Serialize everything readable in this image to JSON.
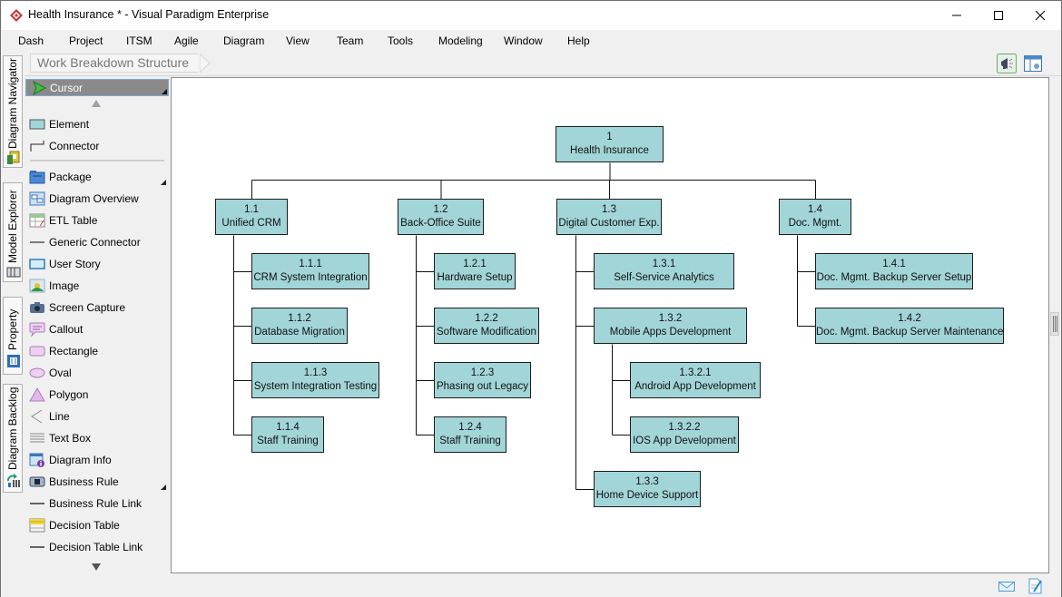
{
  "window": {
    "title": "Health Insurance * - Visual Paradigm Enterprise",
    "controls": [
      "minimize",
      "maximize",
      "close"
    ]
  },
  "menu": [
    "Dash",
    "Project",
    "ITSM",
    "Agile",
    "Diagram",
    "View",
    "Team",
    "Tools",
    "Modeling",
    "Window",
    "Help"
  ],
  "breadcrumb": {
    "label": "Work Breakdown Structure"
  },
  "toolbar": {
    "buttons": [
      "announcement-icon",
      "diagram-layout-icon"
    ]
  },
  "side_tabs": [
    "Diagram Navigator",
    "Model Explorer",
    "Property",
    "Diagram Backlog"
  ],
  "palette": {
    "selected": "Cursor",
    "items": [
      {
        "label": "Element",
        "icon": "element-icon"
      },
      {
        "label": "Connector",
        "icon": "connector-icon"
      },
      {
        "label": "Package",
        "icon": "package-icon",
        "submenu": true
      },
      {
        "label": "Diagram Overview",
        "icon": "diagram-overview-icon"
      },
      {
        "label": "ETL Table",
        "icon": "etl-table-icon"
      },
      {
        "label": "Generic Connector",
        "icon": "generic-connector-icon"
      },
      {
        "label": "User Story",
        "icon": "user-story-icon"
      },
      {
        "label": "Image",
        "icon": "image-icon"
      },
      {
        "label": "Screen Capture",
        "icon": "camera-icon"
      },
      {
        "label": "Callout",
        "icon": "callout-icon"
      },
      {
        "label": "Rectangle",
        "icon": "rectangle-icon"
      },
      {
        "label": "Oval",
        "icon": "oval-icon"
      },
      {
        "label": "Polygon",
        "icon": "polygon-icon"
      },
      {
        "label": "Line",
        "icon": "line-icon"
      },
      {
        "label": "Text Box",
        "icon": "text-box-icon"
      },
      {
        "label": "Diagram Info",
        "icon": "diagram-info-icon"
      },
      {
        "label": "Business Rule",
        "icon": "business-rule-icon",
        "submenu": true
      },
      {
        "label": "Business Rule Link",
        "icon": "business-rule-link-icon"
      },
      {
        "label": "Decision Table",
        "icon": "decision-table-icon"
      },
      {
        "label": "Decision Table Link",
        "icon": "decision-table-link-icon"
      }
    ]
  },
  "wbs": {
    "root": {
      "id": "1",
      "name": "Health Insurance"
    },
    "nodes": [
      {
        "id": "1.1",
        "name": "Unified CRM"
      },
      {
        "id": "1.2",
        "name": "Back-Office Suite"
      },
      {
        "id": "1.3",
        "name": "Digital Customer Exp."
      },
      {
        "id": "1.4",
        "name": "Doc. Mgmt."
      },
      {
        "id": "1.1.1",
        "name": "CRM System Integration"
      },
      {
        "id": "1.1.2",
        "name": "Database Migration"
      },
      {
        "id": "1.1.3",
        "name": "System Integration Testing"
      },
      {
        "id": "1.1.4",
        "name": "Staff Training"
      },
      {
        "id": "1.2.1",
        "name": "Hardware Setup"
      },
      {
        "id": "1.2.2",
        "name": "Software Modification"
      },
      {
        "id": "1.2.3",
        "name": "Phasing out Legacy"
      },
      {
        "id": "1.2.4",
        "name": "Staff Training"
      },
      {
        "id": "1.3.1",
        "name": "Self-Service Analytics"
      },
      {
        "id": "1.3.2",
        "name": "Mobile Apps Development"
      },
      {
        "id": "1.3.2.1",
        "name": "Android App Development"
      },
      {
        "id": "1.3.2.2",
        "name": "IOS App Development"
      },
      {
        "id": "1.3.3",
        "name": "Home Device Support"
      },
      {
        "id": "1.4.1",
        "name": "Doc. Mgmt. Backup Server Setup"
      },
      {
        "id": "1.4.2",
        "name": "Doc. Mgmt. Backup Server Maintenance"
      }
    ]
  },
  "statusbar": {
    "buttons": [
      "mail-icon",
      "edit-document-icon"
    ]
  },
  "colors": {
    "node_fill": "#a2d5d8",
    "node_border": "#1c1c1c",
    "palette_selected": "#8a8a8a"
  }
}
